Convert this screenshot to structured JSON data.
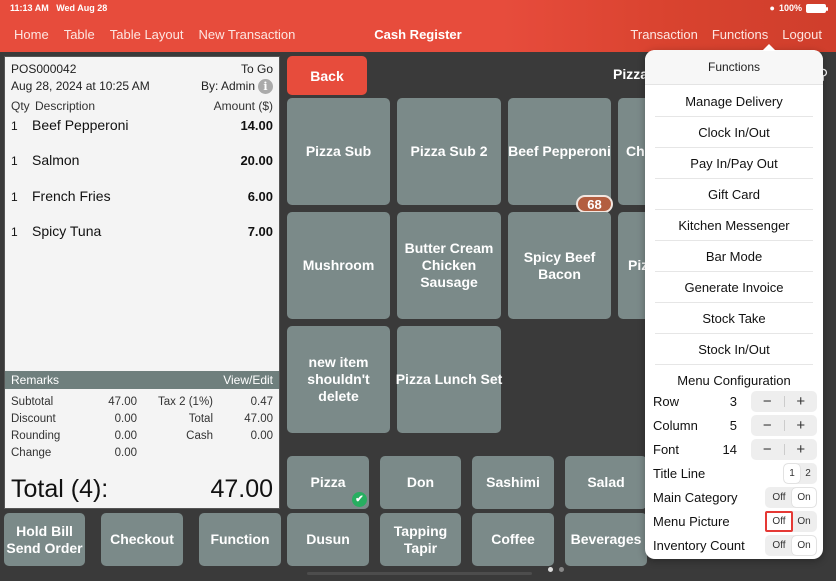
{
  "status_bar": {
    "time": "11:13 AM",
    "date": "Wed Aug 28",
    "battery": "100%"
  },
  "nav": {
    "left": [
      "Home",
      "Table",
      "Table Layout",
      "New Transaction"
    ],
    "title": "Cash Register",
    "right": [
      "Transaction",
      "Functions",
      "Logout"
    ]
  },
  "receipt": {
    "number": "POS000042",
    "order_type": "To Go",
    "datetime": "Aug 28, 2024 at 10:25 AM",
    "by": "By: Admin",
    "columns": {
      "qty": "Qty",
      "desc": "Description",
      "amount": "Amount ($)"
    },
    "items": [
      {
        "qty": "1",
        "desc": "Beef Pepperoni",
        "amount": "14.00"
      },
      {
        "qty": "1",
        "desc": "Salmon",
        "amount": "20.00"
      },
      {
        "qty": "1",
        "desc": "French Fries",
        "amount": "6.00"
      },
      {
        "qty": "1",
        "desc": "Spicy Tuna",
        "amount": "7.00"
      }
    ],
    "remarks_label": "Remarks",
    "view_edit": "View/Edit",
    "totals": [
      {
        "l1": "Subtotal",
        "v1": "47.00",
        "l2": "Tax 2 (1%)",
        "v2": "0.47"
      },
      {
        "l1": "Discount",
        "v1": "0.00",
        "l2": "Total",
        "v2": "47.00"
      },
      {
        "l1": "Rounding",
        "v1": "0.00",
        "l2": "Cash",
        "v2": "0.00"
      },
      {
        "l1": "Change",
        "v1": "0.00",
        "l2": "",
        "v2": ""
      }
    ],
    "grand_label": "Total (4):",
    "grand_value": "47.00"
  },
  "actions": {
    "hold": "Hold Bill\nSend Order",
    "checkout": "Checkout",
    "function": "Function"
  },
  "menu": {
    "back": "Back",
    "category_title": "Pizza",
    "items": [
      {
        "label": "Pizza Sub"
      },
      {
        "label": "Pizza Sub 2"
      },
      {
        "label": "Beef Pepperoni",
        "badge": "68"
      },
      {
        "label": "Ch"
      },
      {
        "label": "Mushroom"
      },
      {
        "label": "Butter Cream Chicken Sausage"
      },
      {
        "label": "Spicy Beef Bacon"
      },
      {
        "label": "Piz"
      },
      {
        "label": "new item shouldn't delete"
      },
      {
        "label": "Pizza Lunch Set"
      }
    ],
    "categories": [
      "Pizza",
      "Don",
      "Sashimi",
      "Salad",
      "Dusun",
      "Tapping Tapir",
      "Coffee",
      "Beverages"
    ],
    "selected_category": "Pizza",
    "page": 1,
    "page_count": 2
  },
  "functions_menu": {
    "title": "Functions",
    "items": [
      "Manage Delivery",
      "Clock In/Out",
      "Pay In/Pay Out",
      "Gift Card",
      "Kitchen Messenger",
      "Bar Mode",
      "Generate Invoice",
      "Stock Take",
      "Stock In/Out"
    ],
    "config_title": "Menu Configuration",
    "steppers": [
      {
        "label": "Row",
        "value": "3"
      },
      {
        "label": "Column",
        "value": "5"
      },
      {
        "label": "Font",
        "value": "14"
      }
    ],
    "title_line": {
      "label": "Title Line",
      "options": [
        "1",
        "2"
      ],
      "selected": "1"
    },
    "toggles": [
      {
        "label": "Main Category",
        "off": "Off",
        "on": "On",
        "value": "On"
      },
      {
        "label": "Menu Picture",
        "off": "Off",
        "on": "On",
        "value": "Off"
      },
      {
        "label": "Inventory Count",
        "off": "Off",
        "on": "On",
        "value": "On"
      }
    ],
    "minus": "−",
    "plus": "+"
  }
}
